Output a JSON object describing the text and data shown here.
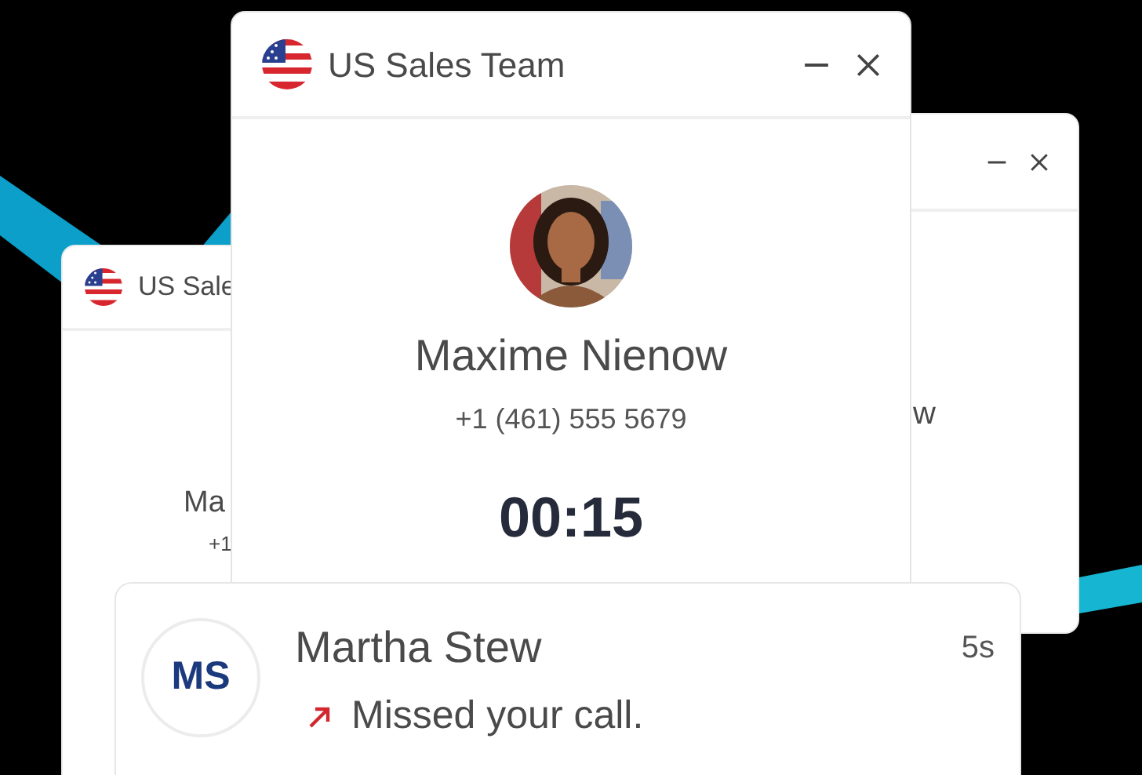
{
  "back_left_window": {
    "title": "US Sale",
    "caller_name": "Ma",
    "caller_phone": "+1"
  },
  "back_right_window": {
    "caller_name": "w"
  },
  "call_window": {
    "title": "US Sales Team",
    "caller_name": "Maxime Nienow",
    "caller_phone": "+1 (461) 555 5679",
    "timer": "00:15"
  },
  "notification": {
    "initials": "MS",
    "name": "Martha Stew",
    "time": "5s",
    "message": "Missed your call."
  }
}
